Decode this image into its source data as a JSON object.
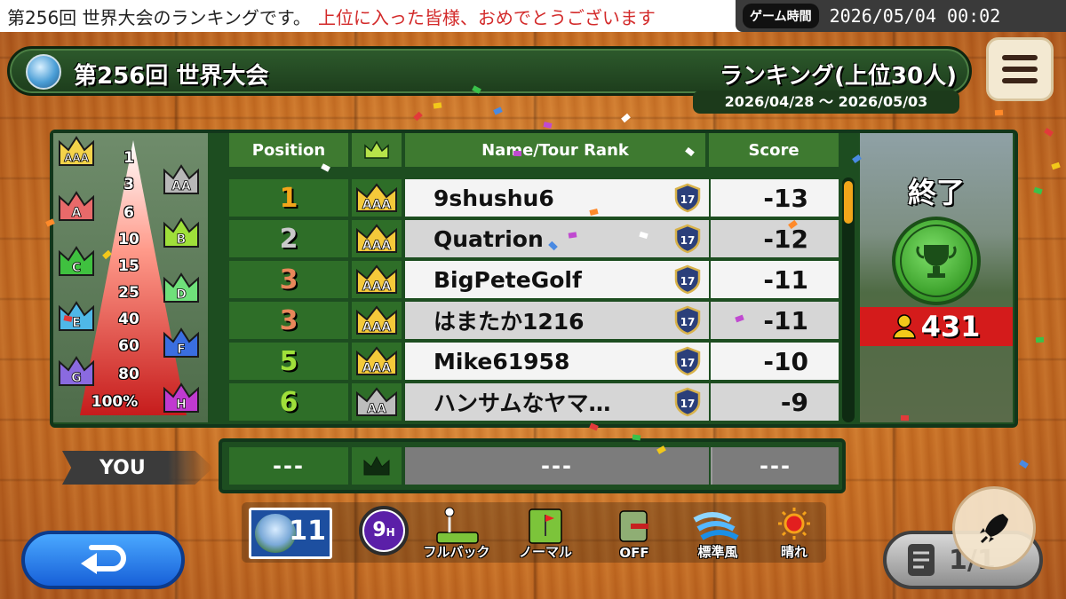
{
  "ticker": {
    "text_main": "第256回 世界大会のランキングです。",
    "text_red": "上位に入った皆様、おめでとうございます"
  },
  "clock": {
    "label": "ゲーム時間",
    "value": "2026/05/04 00:02"
  },
  "header": {
    "title": "第256回 世界大会",
    "ranking_label": "ランキング(上位30人)",
    "date_range": "2026/04/28 〜 2026/05/03"
  },
  "pyramid": {
    "percentiles": [
      "1",
      "3",
      "6",
      "10",
      "15",
      "25",
      "40",
      "60",
      "80",
      "100%"
    ],
    "ranks": [
      {
        "label": "AAA",
        "color": "#f4d34a"
      },
      {
        "label": "AA",
        "color": "#b8b8b8"
      },
      {
        "label": "A",
        "color": "#e86a6a"
      },
      {
        "label": "B",
        "color": "#9fe03a"
      },
      {
        "label": "C",
        "color": "#3fc13f"
      },
      {
        "label": "D",
        "color": "#6fe07a"
      },
      {
        "label": "E",
        "color": "#4fb8e8"
      },
      {
        "label": "F",
        "color": "#3a6ee0"
      },
      {
        "label": "G",
        "color": "#8a6ae0"
      },
      {
        "label": "H",
        "color": "#c03ad0"
      }
    ]
  },
  "table": {
    "headers": {
      "position": "Position",
      "name": "Name/Tour Rank",
      "score": "Score"
    },
    "rows": [
      {
        "position": "1",
        "rank": "AAA",
        "name": "9shushu6",
        "tour_rank": "17",
        "score": "-13",
        "pos_color": "#f2a51a"
      },
      {
        "position": "2",
        "rank": "AAA",
        "name": "Quatrion",
        "tour_rank": "17",
        "score": "-12",
        "pos_color": "#c9c9c9"
      },
      {
        "position": "3",
        "rank": "AAA",
        "name": "BigPeteGolf",
        "tour_rank": "17",
        "score": "-11",
        "pos_color": "#e8875a"
      },
      {
        "position": "3",
        "rank": "AAA",
        "name": "はまたか1216",
        "tour_rank": "17",
        "score": "-11",
        "pos_color": "#e8875a"
      },
      {
        "position": "5",
        "rank": "AAA",
        "name": "Mike61958",
        "tour_rank": "17",
        "score": "-10",
        "pos_color": "#9fe03a"
      },
      {
        "position": "6",
        "rank": "AA",
        "name": "ハンサムなヤマ…",
        "tour_rank": "17",
        "score": "-9",
        "pos_color": "#9fe03a"
      }
    ]
  },
  "status": {
    "state": "終了",
    "participants": "431"
  },
  "you": {
    "label": "YOU",
    "position": "---",
    "name": "---",
    "score": "---"
  },
  "conditions": {
    "course_number": "11",
    "holes": "9",
    "holes_suffix": "H",
    "items": [
      {
        "label": "フルバック",
        "icon": "tee-icon"
      },
      {
        "label": "ノーマル",
        "icon": "green-icon"
      },
      {
        "label": "OFF",
        "icon": "caddie-icon"
      },
      {
        "label": "標準風",
        "icon": "wind-icon"
      },
      {
        "label": "晴れ",
        "icon": "sun-icon"
      }
    ]
  },
  "pager": {
    "value": "1/1"
  }
}
